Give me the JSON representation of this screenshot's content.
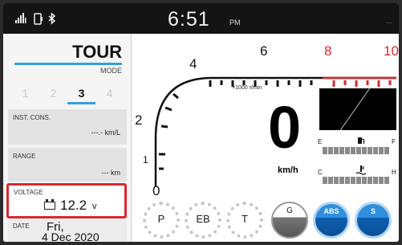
{
  "status_bar": {
    "icons": [
      "signal-icon",
      "phone-icon",
      "bluetooth-icon"
    ],
    "time": "6:51",
    "ampm": "PM"
  },
  "mode": {
    "title": "TOUR",
    "label": "MODE",
    "numbers": [
      "1",
      "2",
      "3",
      "4"
    ],
    "active_index": 2
  },
  "inst_cons": {
    "label": "INST. CONS.",
    "value": "---.- km/L"
  },
  "range": {
    "label": "RANGE",
    "value": "--- km"
  },
  "voltage": {
    "label": "VOLTAGE",
    "value": "12.2",
    "unit": "v"
  },
  "date": {
    "label": "DATE",
    "day": "Fri,",
    "full": "4 Dec 2020"
  },
  "tachometer": {
    "ticks": [
      "0",
      "1",
      "2",
      "4",
      "6",
      "8",
      "10"
    ],
    "redline_ticks": [
      "8",
      "10"
    ],
    "unit_label": "×1000 r/min"
  },
  "speed": {
    "value": "0",
    "unit": "km/h"
  },
  "fuel": {
    "empty_label": "E",
    "full_label": "F"
  },
  "temperature": {
    "cold_label": "C",
    "hot_label": "H"
  },
  "indicators": [
    "P",
    "EB",
    "T",
    "G",
    "ABS",
    "S"
  ],
  "colors": {
    "accent": "#3a9de0",
    "redline": "#d9272e",
    "indicator_blue": "#2f8fde"
  }
}
